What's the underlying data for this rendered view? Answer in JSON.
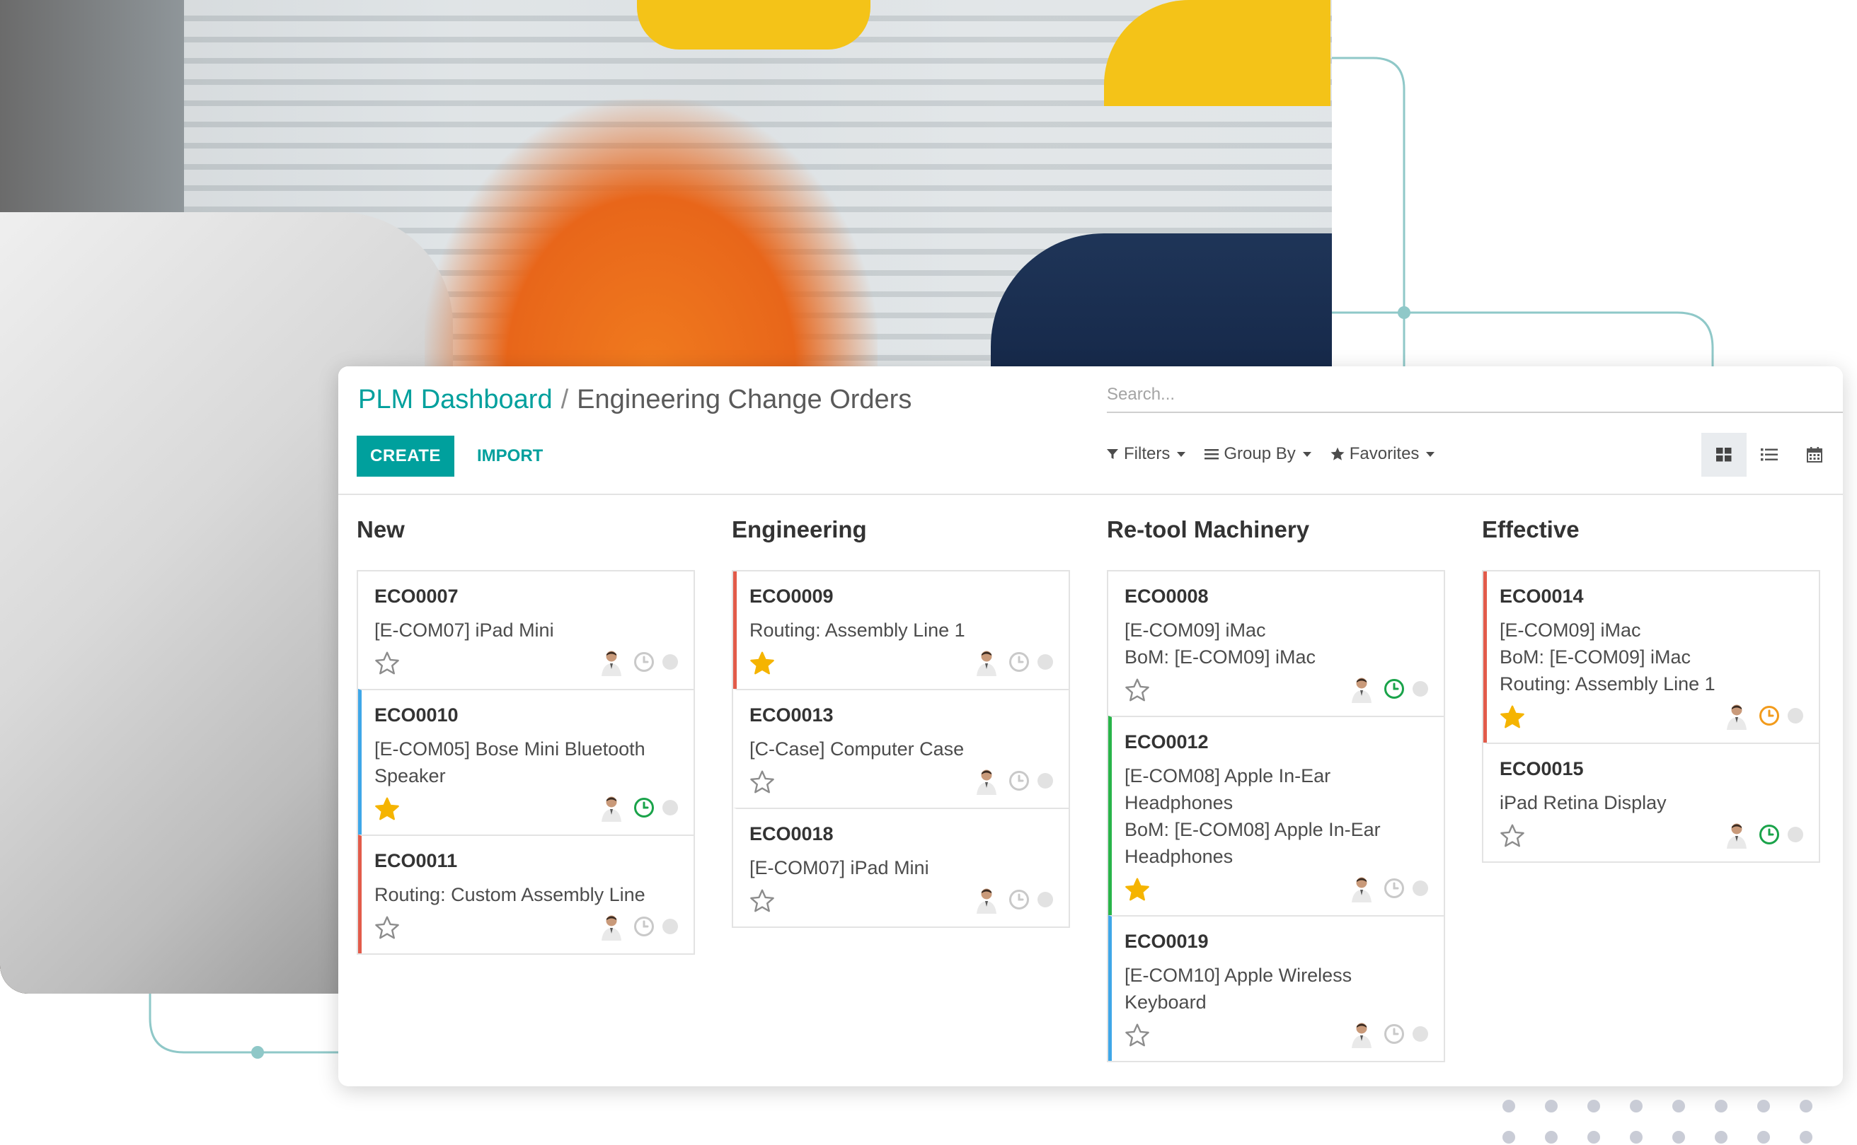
{
  "breadcrumb": {
    "parent": "PLM Dashboard",
    "separator": "/",
    "current": "Engineering Change Orders"
  },
  "search": {
    "placeholder": "Search..."
  },
  "buttons": {
    "create": "CREATE",
    "import": "IMPORT"
  },
  "search_panel": {
    "filters": "Filters",
    "group_by": "Group By",
    "favorites": "Favorites"
  },
  "views": [
    "kanban-icon",
    "list-icon",
    "calendar-icon"
  ],
  "colors": {
    "accent": "#00a09d",
    "red": "#e25b4a",
    "blue": "#3fa7e8",
    "green": "#28b449",
    "star": "#f5b400",
    "clock_green": "#1aa34a",
    "clock_orange": "#f29b1c"
  },
  "columns": [
    {
      "title": "New",
      "cards": [
        {
          "ref": "ECO0007",
          "lines": [
            "[E-COM07] iPad Mini"
          ],
          "starred": false,
          "clock": "gray",
          "color": "none"
        },
        {
          "ref": "ECO0010",
          "lines": [
            "[E-COM05] Bose Mini Bluetooth",
            "Speaker"
          ],
          "starred": true,
          "clock": "green",
          "color": "blue"
        },
        {
          "ref": "ECO0011",
          "lines": [
            "Routing: Custom Assembly Line"
          ],
          "starred": false,
          "clock": "gray",
          "color": "red"
        }
      ]
    },
    {
      "title": "Engineering",
      "cards": [
        {
          "ref": "ECO0009",
          "lines": [
            "Routing: Assembly Line 1"
          ],
          "starred": true,
          "clock": "gray",
          "color": "red"
        },
        {
          "ref": "ECO0013",
          "lines": [
            "[C-Case] Computer Case"
          ],
          "starred": false,
          "clock": "gray",
          "color": "none"
        },
        {
          "ref": "ECO0018",
          "lines": [
            "[E-COM07] iPad Mini"
          ],
          "starred": false,
          "clock": "gray",
          "color": "none"
        }
      ]
    },
    {
      "title": "Re-tool Machinery",
      "cards": [
        {
          "ref": "ECO0008",
          "lines": [
            "[E-COM09] iMac",
            "BoM: [E-COM09] iMac"
          ],
          "starred": false,
          "clock": "green",
          "color": "none"
        },
        {
          "ref": "ECO0012",
          "lines": [
            "[E-COM08] Apple In-Ear",
            "Headphones",
            "BoM: [E-COM08] Apple In-Ear",
            "Headphones"
          ],
          "starred": true,
          "clock": "gray",
          "color": "green"
        },
        {
          "ref": "ECO0019",
          "lines": [
            "[E-COM10] Apple Wireless",
            "Keyboard"
          ],
          "starred": false,
          "clock": "gray",
          "color": "blue"
        }
      ]
    },
    {
      "title": "Effective",
      "cards": [
        {
          "ref": "ECO0014",
          "lines": [
            "[E-COM09] iMac",
            "BoM: [E-COM09] iMac",
            "Routing: Assembly Line 1"
          ],
          "starred": true,
          "clock": "orange",
          "color": "red"
        },
        {
          "ref": "ECO0015",
          "lines": [
            "iPad Retina Display"
          ],
          "starred": false,
          "clock": "green",
          "color": "none"
        }
      ]
    }
  ]
}
